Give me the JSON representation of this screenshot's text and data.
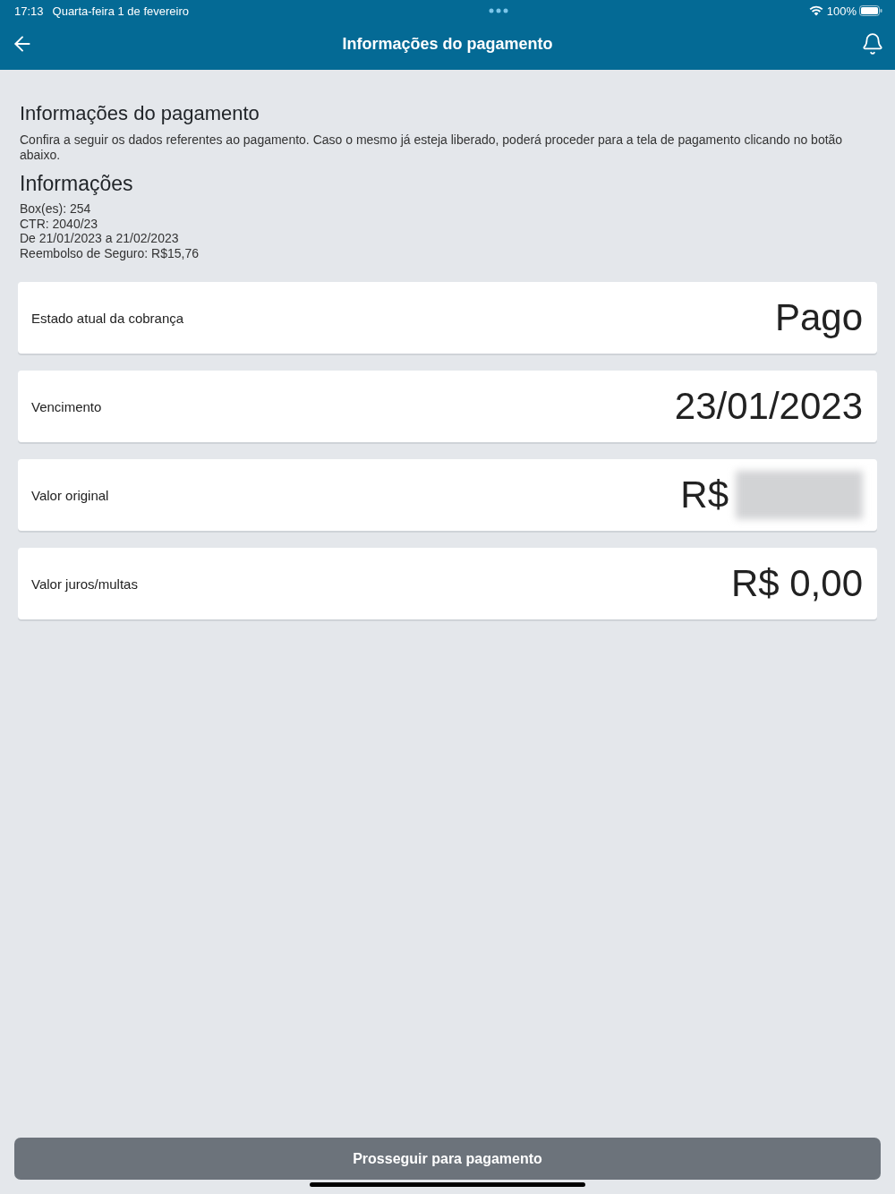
{
  "status_bar": {
    "time": "17:13",
    "date": "Quarta-feira 1 de fevereiro",
    "battery": "100%"
  },
  "header": {
    "title": "Informações do pagamento"
  },
  "intro": {
    "title": "Informações do pagamento",
    "text": "Confira a seguir os dados referentes ao pagamento. Caso o mesmo já esteja liberado, poderá proceder para a tela de pagamento clicando no botão abaixo."
  },
  "details": {
    "title": "Informações",
    "lines": [
      "Box(es): 254",
      "CTR: 2040/23",
      "De 21/01/2023 a 21/02/2023",
      "Reembolso de Seguro: R$15,76"
    ]
  },
  "cards": [
    {
      "label": "Estado atual da cobrança",
      "value": "Pago",
      "redacted": false
    },
    {
      "label": "Vencimento",
      "value": "23/01/2023",
      "redacted": false
    },
    {
      "label": "Valor original",
      "value": "R$",
      "redacted": true
    },
    {
      "label": "Valor juros/multas",
      "value": "R$ 0,00",
      "redacted": false
    }
  ],
  "action": {
    "label": "Prosseguir para pagamento",
    "disabled": true
  }
}
